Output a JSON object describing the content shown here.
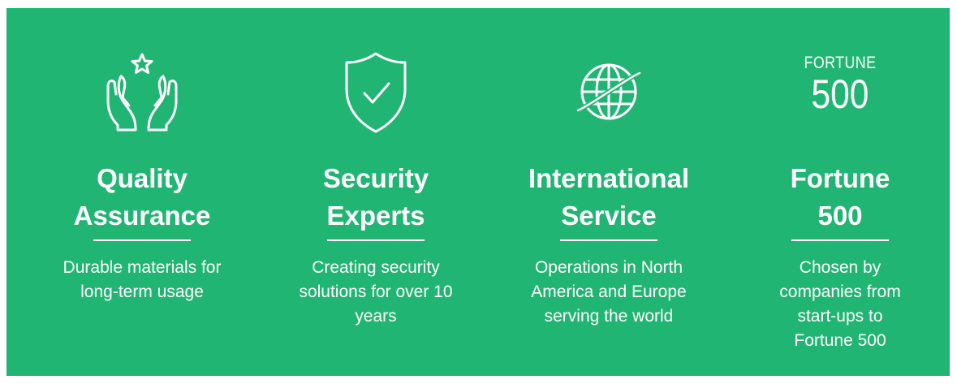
{
  "colors": {
    "background": "#21b573",
    "foreground": "#ffffff"
  },
  "features": [
    {
      "icon": "hands-star-icon",
      "title_line1": "Quality",
      "title_line2": "Assurance",
      "description": "Durable materials for long-term usage"
    },
    {
      "icon": "shield-check-icon",
      "title_line1": "Security",
      "title_line2": "Experts",
      "description": "Creating security solutions for over 10 years"
    },
    {
      "icon": "globe-icon",
      "title_line1": "International",
      "title_line2": "Service",
      "description": "Operations in North America and Europe serving the world"
    },
    {
      "icon": "fortune-500-logo",
      "logo_word": "FORTUNE",
      "logo_number": "500",
      "title_line1": "Fortune",
      "title_line2": "500",
      "description": "Chosen by companies from start-ups to Fortune 500"
    }
  ]
}
